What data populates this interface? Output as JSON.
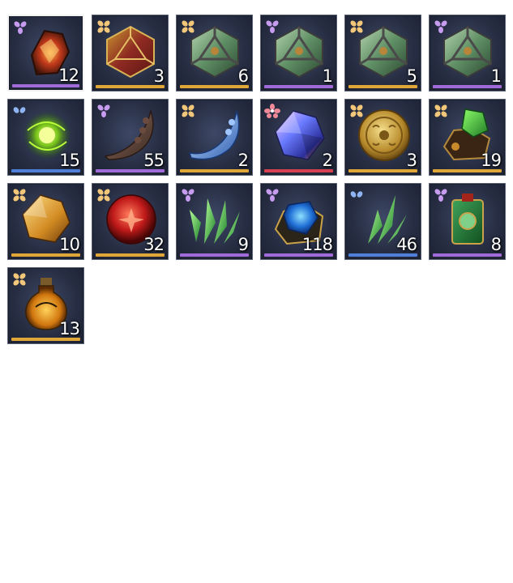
{
  "colors": {
    "gold": "#e0a637",
    "purple": "#a06ad8",
    "blue": "#4f7fd8",
    "red": "#d64050",
    "slot_bg": "#262d42"
  },
  "inventory": {
    "items": [
      {
        "name": "fire-ore-icon",
        "count": "12",
        "rarity": "purple",
        "selected": true
      },
      {
        "name": "red-gold-d20-die-icon",
        "count": "3",
        "rarity": "gold"
      },
      {
        "name": "jade-d20-die-icon",
        "count": "6",
        "rarity": "gold"
      },
      {
        "name": "jade-d20-die-icon",
        "count": "1",
        "rarity": "purple"
      },
      {
        "name": "jade-d20-die-icon",
        "count": "5",
        "rarity": "gold"
      },
      {
        "name": "jade-d20-die-icon",
        "count": "1",
        "rarity": "purple"
      },
      {
        "name": "green-energy-orb-icon",
        "count": "15",
        "rarity": "blue"
      },
      {
        "name": "beast-claw-icon",
        "count": "55",
        "rarity": "purple"
      },
      {
        "name": "ice-claw-icon",
        "count": "2",
        "rarity": "gold"
      },
      {
        "name": "prismatic-crystal-icon",
        "count": "2",
        "rarity": "red"
      },
      {
        "name": "gold-coin-icon",
        "count": "3",
        "rarity": "gold"
      },
      {
        "name": "emerald-ore-icon",
        "count": "19",
        "rarity": "gold"
      },
      {
        "name": "amber-crystal-icon",
        "count": "10",
        "rarity": "gold"
      },
      {
        "name": "red-flower-orb-icon",
        "count": "32",
        "rarity": "gold"
      },
      {
        "name": "green-crystal-cluster-icon",
        "count": "9",
        "rarity": "purple"
      },
      {
        "name": "sapphire-ore-icon",
        "count": "118",
        "rarity": "purple"
      },
      {
        "name": "green-crystal-shard-icon",
        "count": "46",
        "rarity": "blue"
      },
      {
        "name": "jade-talisman-icon",
        "count": "8",
        "rarity": "purple"
      },
      {
        "name": "amber-potion-icon",
        "count": "13",
        "rarity": "gold"
      }
    ]
  }
}
